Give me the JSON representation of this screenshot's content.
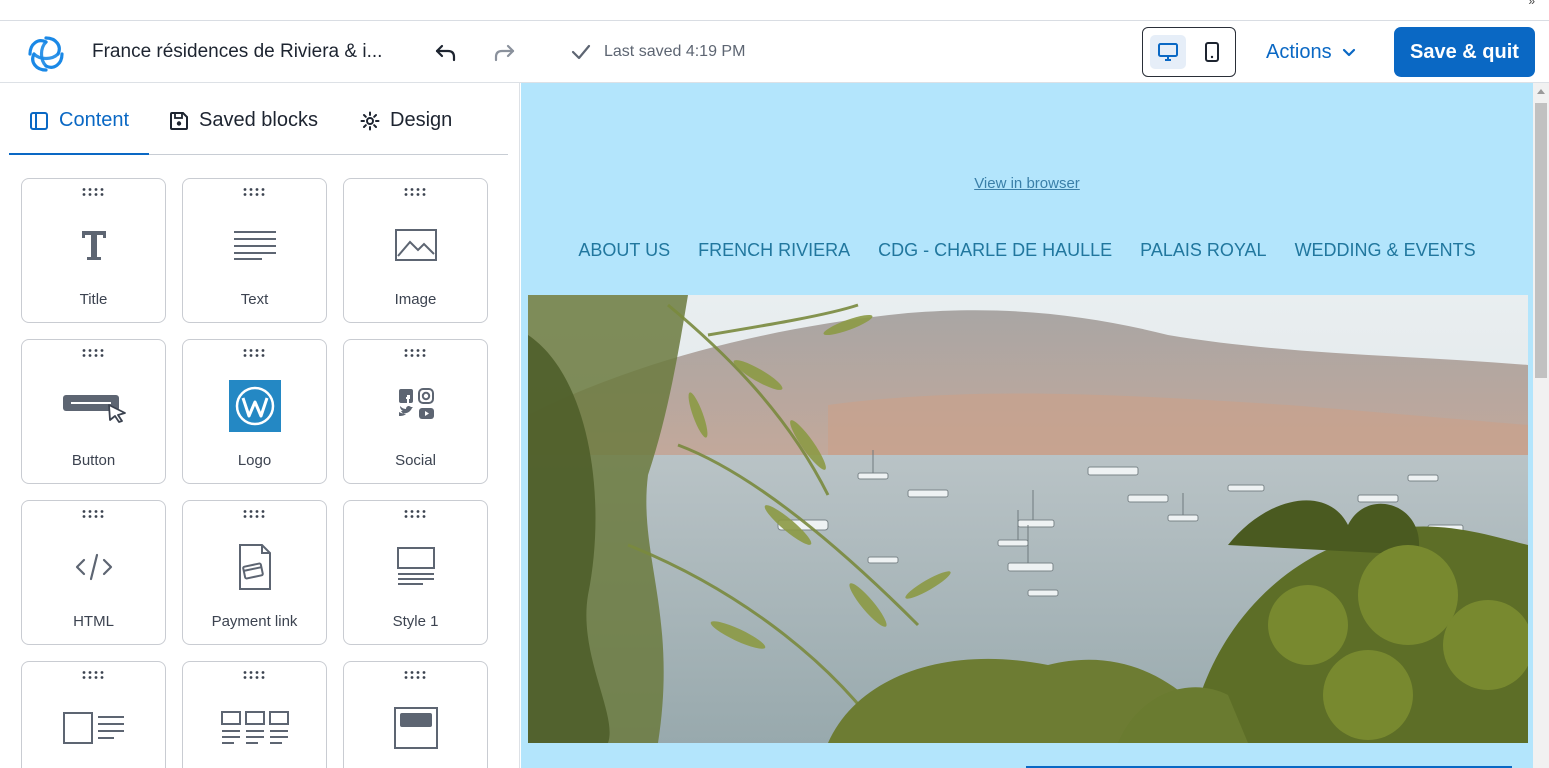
{
  "header": {
    "doc_title": "France résidences de Riviera & i...",
    "saved_status": "Last saved 4:19 PM",
    "actions_label": "Actions",
    "save_label": "Save & quit"
  },
  "sidebar": {
    "tabs": [
      {
        "label": "Content",
        "icon": "panel-icon",
        "active": true
      },
      {
        "label": "Saved blocks",
        "icon": "floppy-disk-icon",
        "active": false
      },
      {
        "label": "Design",
        "icon": "gear-icon",
        "active": false
      }
    ],
    "blocks": [
      {
        "label": "Title",
        "icon": "title-T-icon"
      },
      {
        "label": "Text",
        "icon": "text-lines-icon"
      },
      {
        "label": "Image",
        "icon": "image-icon"
      },
      {
        "label": "Button",
        "icon": "button-cursor-icon"
      },
      {
        "label": "Logo",
        "icon": "wordpress-logo-icon"
      },
      {
        "label": "Social",
        "icon": "social-icons-icon"
      },
      {
        "label": "HTML",
        "icon": "code-icon"
      },
      {
        "label": "Payment link",
        "icon": "payment-document-icon"
      },
      {
        "label": "Style 1",
        "icon": "layout-style-1-icon"
      },
      {
        "label": "",
        "icon": "image-text-layout-icon"
      },
      {
        "label": "",
        "icon": "three-column-layout-icon"
      },
      {
        "label": "",
        "icon": "header-image-layout-icon"
      }
    ]
  },
  "canvas": {
    "view_in_browser": "View in browser",
    "nav": [
      "ABOUT US",
      "FRENCH RIVIERA",
      "CDG - CHARLE DE HAULLE",
      "PALAIS ROYAL",
      "WEDDING & EVENTS"
    ],
    "background_color": "#b3e5fc",
    "hero_description": ""
  },
  "colors": {
    "accent": "#0a68c4",
    "nav_text": "#21779e"
  }
}
